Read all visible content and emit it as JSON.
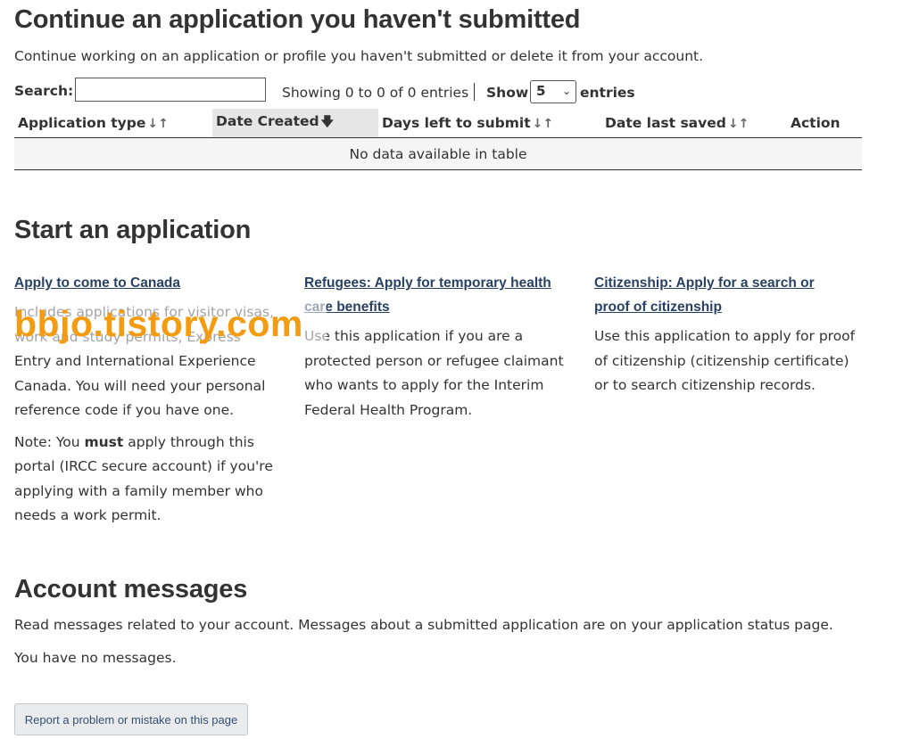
{
  "continue_section": {
    "title": "Continue an application you haven't submitted",
    "description": "Continue working on an application or profile you haven't submitted or delete it from your account."
  },
  "table_controls": {
    "search_label": "Search:",
    "search_value": "",
    "showing_text": "Showing 0 to 0 of 0 entries",
    "show_label": "Show",
    "show_value": "5",
    "entries_label": "entries"
  },
  "table": {
    "columns": [
      {
        "label": "Application type",
        "sort_icon": "sort-both-icon"
      },
      {
        "label": "Date Created",
        "sort_icon": "sort-desc-icon"
      },
      {
        "label": "Days left to submit",
        "sort_icon": "sort-both-icon"
      },
      {
        "label": "Date last saved",
        "sort_icon": "sort-both-icon"
      },
      {
        "label": "Action",
        "sort_icon": ""
      }
    ],
    "empty_message": "No data available in table"
  },
  "start_section": {
    "title": "Start an application",
    "options": [
      {
        "link_line1": "Apply to come to Canada",
        "link_line2": "",
        "description": "Includes applications for visitor visas, work and study permits, Express Entry and International Experience Canada. You will need your personal reference code if you have one.",
        "note_prefix": "Note: You ",
        "note_bold": "must",
        "note_suffix": " apply through this portal (IRCC secure account) if you're applying with a family member who needs a work permit."
      },
      {
        "link_line1": "Refugees: Apply for temporary health",
        "link_line2": "care benefits",
        "description": "Use this application if you are a protected person or refugee claimant who wants to apply for the Interim Federal Health Program."
      },
      {
        "link_line1": "Citizenship: Apply for a search or",
        "link_line2": "proof of citizenship ",
        "description": "Use this application to apply for proof of citizenship (citizenship certificate) or to search citizenship records."
      }
    ]
  },
  "watermark": {
    "text": "bbjo.tistory.com",
    "color": "#f39c12"
  },
  "account_section": {
    "title": "Account messages",
    "description": "Read messages related to your account. Messages about a submitted application are on your application status page.",
    "no_messages": "You have no messages."
  },
  "report_button": {
    "label": "Report a problem or mistake on this page"
  },
  "colors": {
    "link": "#284162",
    "text": "#333333",
    "sorted_header_bg": "#e6e6e6",
    "empty_row_bg": "#f5f5f5"
  }
}
